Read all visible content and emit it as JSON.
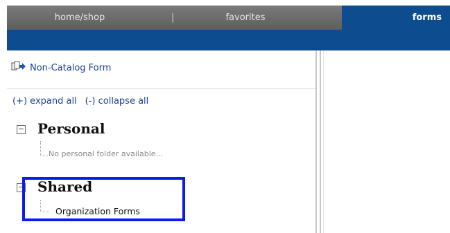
{
  "nav": {
    "tabs": [
      {
        "label": "home/shop"
      },
      {
        "label": "favorites"
      },
      {
        "label": "forms"
      }
    ],
    "separator": "|",
    "active_color": "#0d4c8f"
  },
  "sidebar": {
    "non_catalog_form": {
      "label": "Non-Catalog Form",
      "icon": "form-arrow-icon"
    },
    "expand_all": "(+) expand all",
    "collapse_all": "(-) collapse all",
    "sections": [
      {
        "title": "Personal",
        "toggle": "−",
        "empty_text": "No personal folder available..."
      },
      {
        "title": "Shared",
        "toggle": "−",
        "items": [
          {
            "label": "Organization Forms"
          }
        ]
      }
    ],
    "highlight_color": "#0a1cf0"
  }
}
